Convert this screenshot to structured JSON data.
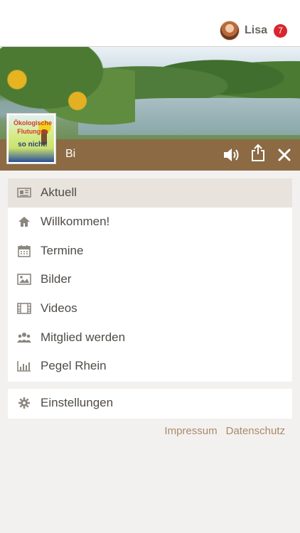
{
  "header": {
    "user_name": "Lisa",
    "notification_count": "7",
    "avatar_icon": "user-avatar"
  },
  "player": {
    "title": "Bi",
    "sound_icon": "speaker-icon",
    "share_icon": "share-icon",
    "close_icon": "close-icon",
    "bar_color": "#8b6a44"
  },
  "logo": {
    "line1": "Ökologische",
    "line2": "Flutungen",
    "line3": "so nicht!"
  },
  "menu": {
    "items": [
      {
        "label": "Aktuell",
        "icon": "news-icon",
        "active": true
      },
      {
        "label": "Willkommen!",
        "icon": "home-icon",
        "active": false
      },
      {
        "label": "Termine",
        "icon": "calendar-icon",
        "active": false
      },
      {
        "label": "Bilder",
        "icon": "image-icon",
        "active": false
      },
      {
        "label": "Videos",
        "icon": "film-icon",
        "active": false
      },
      {
        "label": "Mitglied werden",
        "icon": "group-icon",
        "active": false
      },
      {
        "label": "Pegel Rhein",
        "icon": "bar-chart-icon",
        "active": false
      }
    ],
    "settings": {
      "label": "Einstellungen",
      "icon": "gear-icon"
    }
  },
  "footer": {
    "impressum": "Impressum",
    "datenschutz": "Datenschutz"
  },
  "colors": {
    "accent": "#8b6a44",
    "badge": "#d9262e",
    "link": "#a88a6a",
    "background": "#f3f1ef"
  }
}
